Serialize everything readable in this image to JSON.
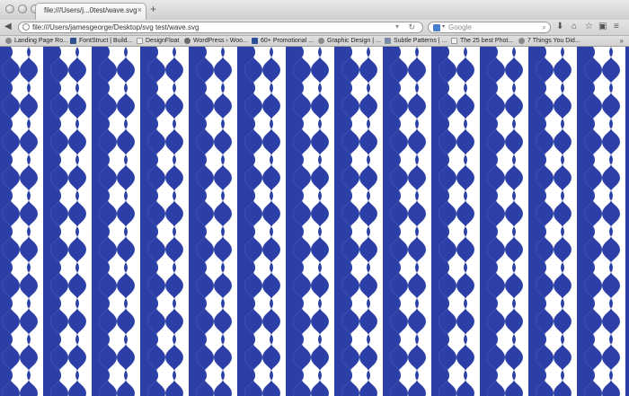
{
  "window": {
    "tab": {
      "title": "file:///Users/j...0test/wave.svg",
      "close_glyph": "×"
    },
    "new_tab_glyph": "+"
  },
  "navbar": {
    "url": "file:///Users/jamesgeorge/Desktop/svg test/wave.svg",
    "search_placeholder": "Google"
  },
  "bookmarks": [
    {
      "label": "Landing Page Ro...",
      "icon": "gear-icon",
      "color": "#777777"
    },
    {
      "label": "FontStruct | Build...",
      "icon": "fontstruct-icon",
      "color": "#2f4f8f"
    },
    {
      "label": "DesignFloat",
      "icon": "page-icon",
      "color": "#d8d8d8"
    },
    {
      "label": "WordPress › Woo...",
      "icon": "wordpress-icon",
      "color": "#6b6b6b"
    },
    {
      "label": "60+ Promotional ...",
      "icon": "bookmark-icon",
      "color": "#2c4f9a"
    },
    {
      "label": "Graphic Design | ...",
      "icon": "gear-icon",
      "color": "#777777"
    },
    {
      "label": "Subtle Patterns | ...",
      "icon": "pattern-icon",
      "color": "#7b8aa8"
    },
    {
      "label": "The 25 best Phot...",
      "icon": "page-icon",
      "color": "#e6e6e6"
    },
    {
      "label": "7 Things You Did...",
      "icon": "gear-icon",
      "color": "#777777"
    }
  ],
  "colors": {
    "pattern_blue": "#2b3fa6",
    "pattern_white": "#ffffff"
  },
  "pattern": {
    "description_icon": "wave-scale-pattern"
  }
}
